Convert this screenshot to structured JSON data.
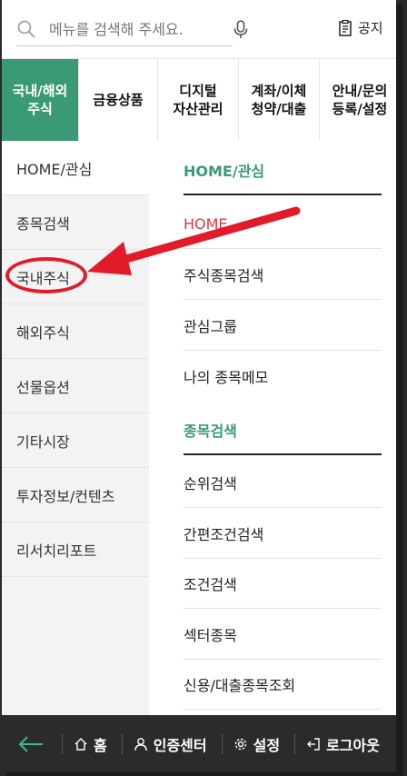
{
  "search": {
    "placeholder": "메뉴를 검색해 주세요."
  },
  "header": {
    "notice_label": "공지"
  },
  "tabs": [
    {
      "label": "국내/해외\n주식",
      "active": true
    },
    {
      "label": "금융상품",
      "active": false
    },
    {
      "label": "디지털\n자산관리",
      "active": false
    },
    {
      "label": "계좌/이체\n청약/대출",
      "active": false
    },
    {
      "label": "안내/문의\n등록/설정",
      "active": false
    }
  ],
  "left_menu": [
    "HOME/관심",
    "종목검색",
    "국내주식",
    "해외주식",
    "선물옵션",
    "기타시장",
    "투자정보/컨텐츠",
    "리서치리포트"
  ],
  "right_menu": [
    {
      "label": "HOME/관심",
      "kind": "section"
    },
    {
      "label": "HOME",
      "kind": "highlight"
    },
    {
      "label": "주식종목검색",
      "kind": "item"
    },
    {
      "label": "관심그룹",
      "kind": "item"
    },
    {
      "label": "나의 종목메모",
      "kind": "item"
    },
    {
      "label": "종목검색",
      "kind": "section"
    },
    {
      "label": "순위검색",
      "kind": "item"
    },
    {
      "label": "간편조건검색",
      "kind": "item"
    },
    {
      "label": "조건검색",
      "kind": "item"
    },
    {
      "label": "섹터종목",
      "kind": "item"
    },
    {
      "label": "신용/대출종목조회",
      "kind": "item"
    }
  ],
  "bottom_bar": {
    "home": "홈",
    "cert_center": "인증센터",
    "settings": "설정",
    "logout": "로그아웃"
  },
  "colors": {
    "accent": "#3a9a75",
    "annotation": "#e11c28",
    "bottom_bar": "#2b2b2b"
  }
}
